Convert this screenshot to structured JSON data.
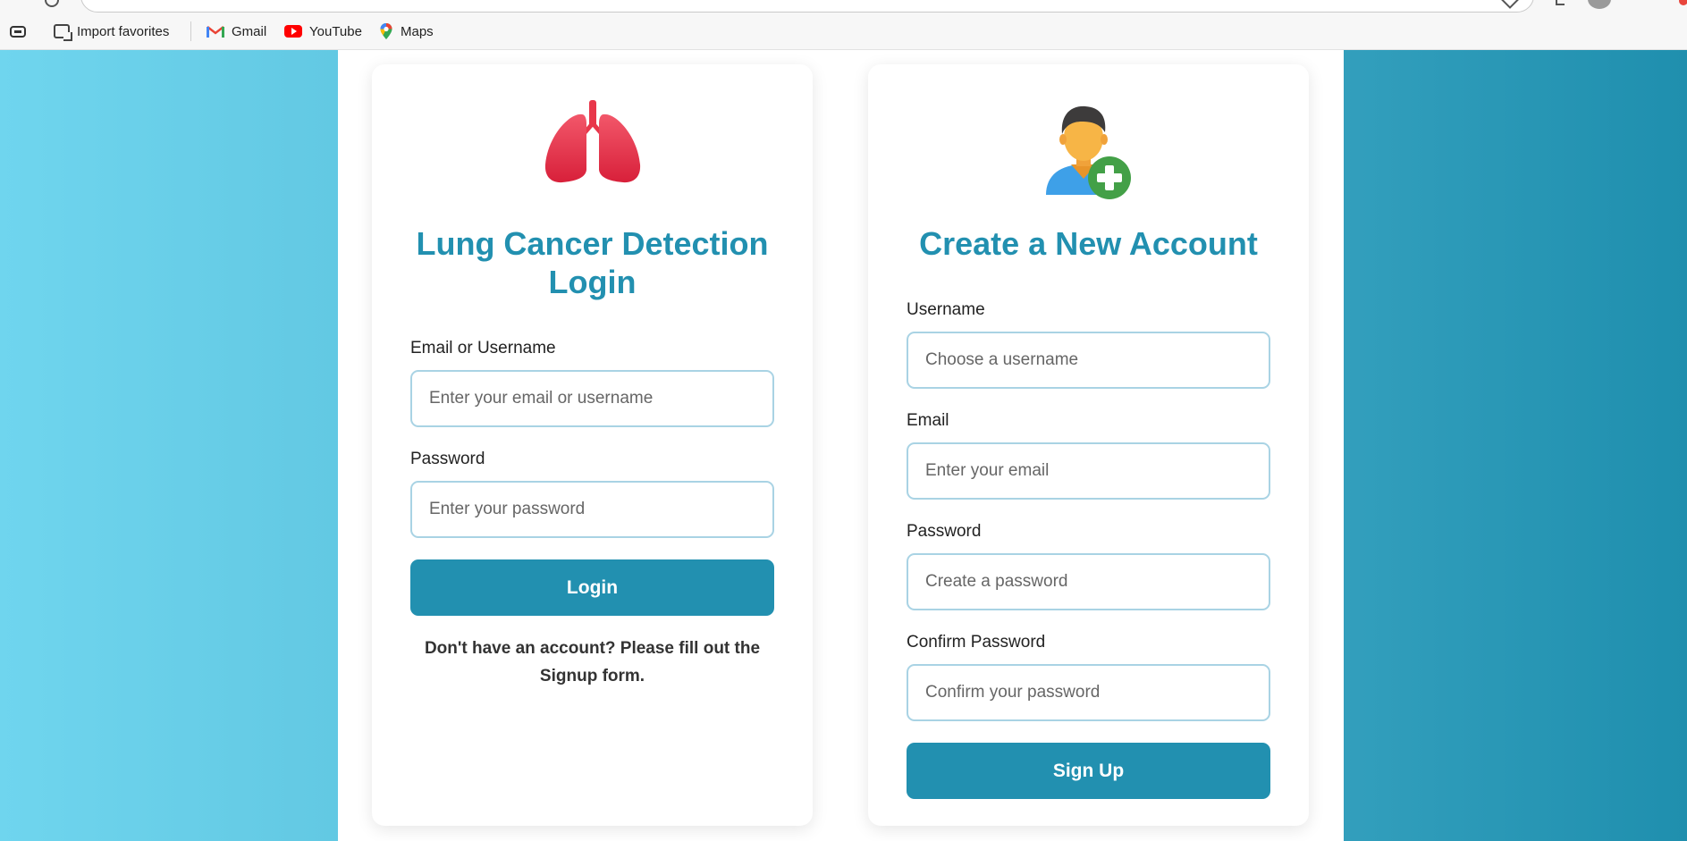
{
  "bookmarks": {
    "items": [
      {
        "label": "Import favorites",
        "icon": "import-icon"
      },
      {
        "label": "Gmail",
        "icon": "gmail-icon"
      },
      {
        "label": "YouTube",
        "icon": "youtube-icon"
      },
      {
        "label": "Maps",
        "icon": "maps-icon"
      }
    ]
  },
  "login": {
    "icon": "lungs-icon",
    "title": "Lung Cancer Detection Login",
    "email_label": "Email or Username",
    "email_placeholder": "Enter your email or username",
    "password_label": "Password",
    "password_placeholder": "Enter your password",
    "button_label": "Login",
    "helper_text": "Don't have an account? Please fill out the Signup form."
  },
  "signup": {
    "icon": "add-user-icon",
    "title": "Create a New Account",
    "username_label": "Username",
    "username_placeholder": "Choose a username",
    "email_label": "Email",
    "email_placeholder": "Enter your email",
    "password_label": "Password",
    "password_placeholder": "Create a password",
    "confirm_label": "Confirm Password",
    "confirm_placeholder": "Confirm your password",
    "button_label": "Sign Up"
  },
  "colors": {
    "accent": "#2290b0",
    "background_left": "#6fd5ee",
    "background_right": "#1f8fae",
    "input_border": "#a9d3e4",
    "lungs": "#e8364a",
    "add_badge": "#43a047"
  }
}
